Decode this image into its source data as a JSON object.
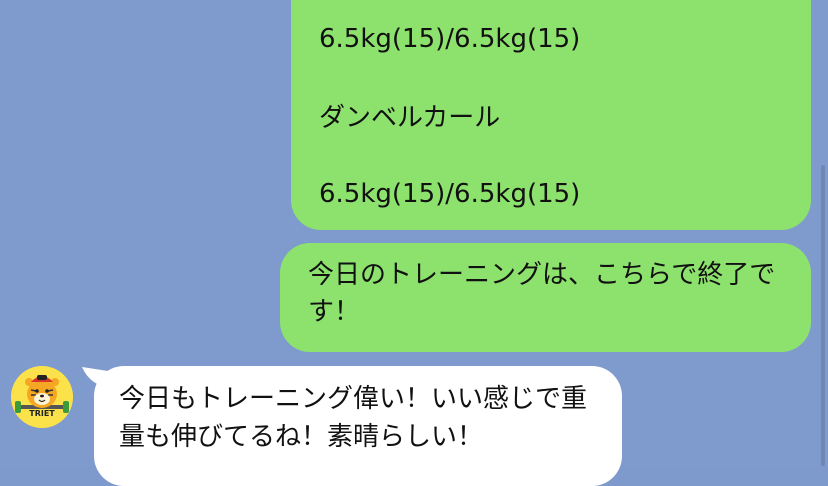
{
  "messages": [
    {
      "from": "me",
      "lines": [
        "6.5kg(15)/6.5kg(15)",
        "ダンベルカール",
        "6.5kg(15)/6.5kg(15)"
      ]
    },
    {
      "from": "me",
      "text": "今日のトレーニングは、こちらで終了です！"
    },
    {
      "from": "trainer",
      "avatar_label": "TRIET",
      "text": "今日もトレーニング偉い！いい感じで重量も伸びてるね！素晴らしい！"
    }
  ],
  "colors": {
    "background": "#7f9bce",
    "outgoing_bubble": "#8de26d",
    "incoming_bubble": "#ffffff",
    "avatar_bg": "#fbe24a"
  },
  "icons": {
    "avatar": "tiger-mascot-icon"
  }
}
